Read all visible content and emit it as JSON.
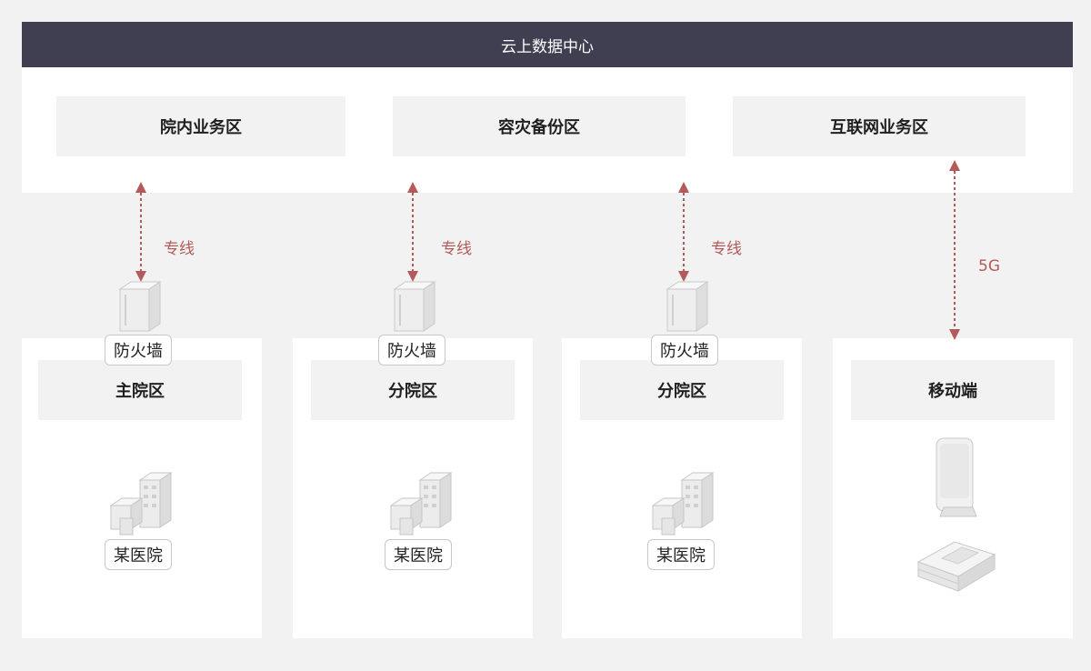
{
  "cloud": {
    "title": "云上数据中心",
    "zones": [
      "院内业务区",
      "容灾备份区",
      "互联网业务区"
    ]
  },
  "links": [
    {
      "label": "专线"
    },
    {
      "label": "专线"
    },
    {
      "label": "专线"
    },
    {
      "label": "5G"
    }
  ],
  "firewall_label": "防火墙",
  "hospital_label": "某医院",
  "panels": [
    {
      "title": "主院区"
    },
    {
      "title": "分院区"
    },
    {
      "title": "分院区"
    },
    {
      "title": "移动端"
    }
  ],
  "colors": {
    "header_bg": "#3f3f51",
    "link": "#b35a5a",
    "zone_bg": "#f2f2f2"
  },
  "icons": [
    "firewall-icon",
    "hospital-building-icon",
    "mobile-terminal-icon",
    "tablet-device-icon"
  ]
}
